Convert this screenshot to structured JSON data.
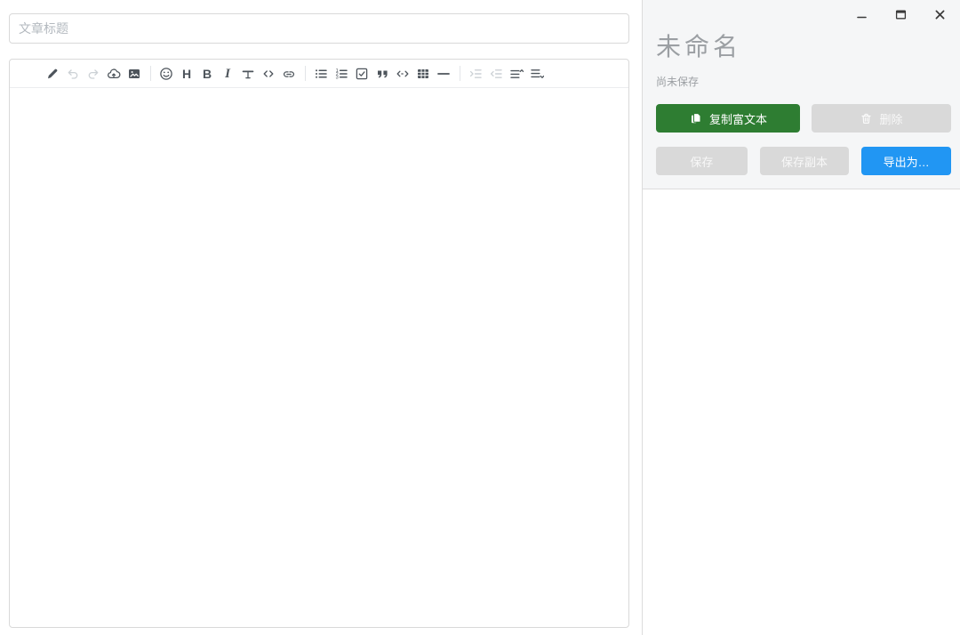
{
  "editor": {
    "title_placeholder": "文章标题",
    "toolbar_groups": [
      {
        "items": [
          {
            "name": "edit",
            "enabled": true
          },
          {
            "name": "undo",
            "enabled": false
          },
          {
            "name": "redo",
            "enabled": false
          },
          {
            "name": "upload",
            "enabled": true
          },
          {
            "name": "image",
            "enabled": true
          }
        ]
      },
      {
        "items": [
          {
            "name": "emoji",
            "enabled": true
          },
          {
            "name": "heading",
            "enabled": true
          },
          {
            "name": "bold",
            "enabled": true
          },
          {
            "name": "italic",
            "enabled": true
          },
          {
            "name": "strikethrough",
            "enabled": true
          },
          {
            "name": "inline-code",
            "enabled": true
          },
          {
            "name": "link",
            "enabled": true
          }
        ]
      },
      {
        "items": [
          {
            "name": "unordered-list",
            "enabled": true
          },
          {
            "name": "ordered-list",
            "enabled": true
          },
          {
            "name": "task-list",
            "enabled": true
          },
          {
            "name": "quote",
            "enabled": true
          },
          {
            "name": "code-block",
            "enabled": true
          },
          {
            "name": "table",
            "enabled": true
          },
          {
            "name": "horizontal-rule",
            "enabled": true
          }
        ]
      },
      {
        "items": [
          {
            "name": "indent",
            "enabled": false
          },
          {
            "name": "outdent",
            "enabled": false
          },
          {
            "name": "insert-before",
            "enabled": true
          },
          {
            "name": "insert-after",
            "enabled": true
          }
        ]
      }
    ]
  },
  "panel": {
    "title": "未命名",
    "status": "尚未保存",
    "copy_rich_text_label": "复制富文本",
    "delete_label": "删除",
    "save_label": "保存",
    "save_copy_label": "保存副本",
    "export_label": "导出为…"
  },
  "colors": {
    "primary_green": "#2e7d32",
    "primary_blue": "#2196f3",
    "disabled_gray": "#d9d9d9",
    "panel_background": "#f5f6f7",
    "toolbar_icon": "#4d545b",
    "muted_text": "#9b9fa3"
  }
}
